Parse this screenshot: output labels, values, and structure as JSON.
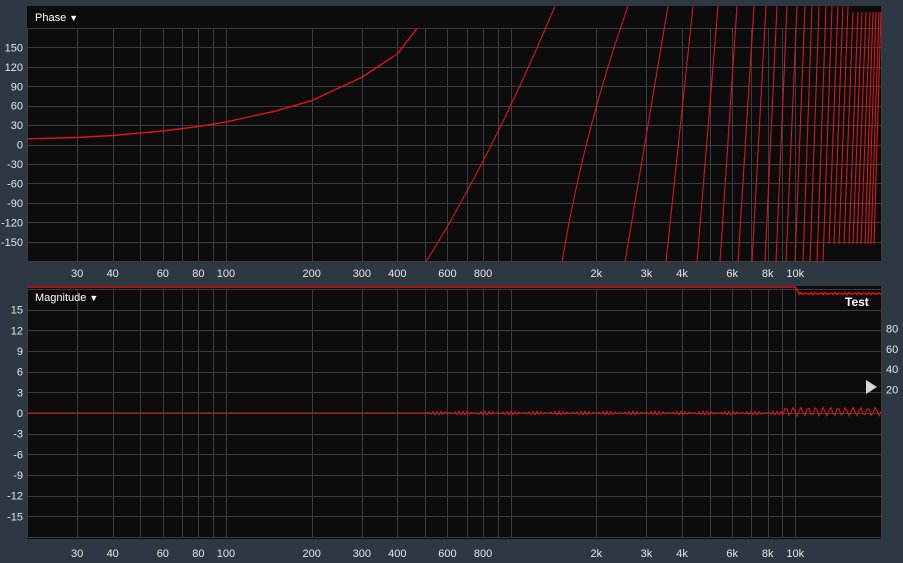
{
  "phase_panel": {
    "title": "Phase",
    "dropdown_icon": "triangle-down-icon",
    "y_ticks": [
      "150",
      "120",
      "90",
      "60",
      "30",
      "0",
      "-30",
      "-60",
      "-90",
      "-120",
      "-150"
    ],
    "x_ticks": [
      "30",
      "40",
      "60",
      "80",
      "100",
      "200",
      "300",
      "400",
      "600",
      "800",
      "2k",
      "3k",
      "4k",
      "6k",
      "8k",
      "10k"
    ]
  },
  "magnitude_panel": {
    "title": "Magnitude",
    "dropdown_icon": "triangle-down-icon",
    "y_ticks": [
      "15",
      "12",
      "9",
      "6",
      "3",
      "0",
      "-3",
      "-6",
      "-9",
      "-12",
      "-15"
    ],
    "right_ticks": [
      "80",
      "60",
      "40",
      "20"
    ],
    "x_ticks": [
      "30",
      "40",
      "60",
      "80",
      "100",
      "200",
      "300",
      "400",
      "600",
      "800",
      "2k",
      "3k",
      "4k",
      "6k",
      "8k",
      "10k"
    ],
    "legend": "Test",
    "slider_icon": "triangle-right-icon"
  },
  "colors": {
    "trace": "#e01414",
    "background": "#0c0c0d",
    "frame": "#2e3842",
    "grid": "#3a3c40"
  },
  "chart_data": [
    {
      "type": "line",
      "title": "Phase",
      "x_scale": "log",
      "xlim": [
        20,
        20000
      ],
      "ylim": [
        -180,
        180
      ],
      "series": [
        {
          "x": [
            20,
            30,
            40,
            60,
            80,
            100,
            150,
            200,
            300,
            400,
            470
          ],
          "y": [
            9,
            11,
            14,
            21,
            28,
            35,
            52,
            68,
            104,
            140,
            180
          ]
        }
      ],
      "note_visible": "phase wraps repeatedly between -180 and 180 above ~500 Hz"
    },
    {
      "type": "line",
      "title": "Magnitude",
      "x_scale": "log",
      "xlim": [
        20,
        20000
      ],
      "ylim": [
        -18,
        18
      ],
      "series": [
        {
          "x": [
            20,
            1000,
            5000,
            10000,
            15000,
            20000
          ],
          "y": [
            0,
            0,
            0.1,
            0.1,
            0.2,
            0.1
          ]
        }
      ],
      "secondary_series": {
        "label": "Test",
        "right_axis_ticks": [
          80,
          60,
          40,
          20
        ],
        "x": [
          20,
          1500,
          10000,
          11000,
          20000
        ],
        "y": [
          99,
          99,
          99,
          92,
          93
        ]
      }
    }
  ]
}
